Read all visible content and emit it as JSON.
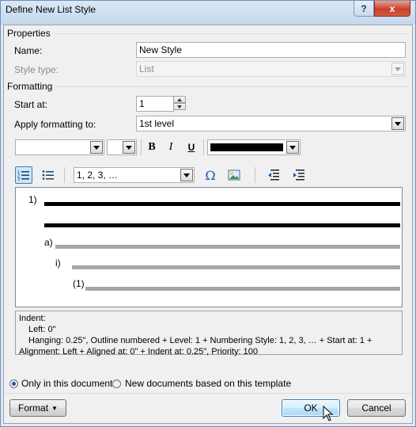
{
  "window": {
    "title": "Define New List Style",
    "help_label": "?",
    "close_label": "x"
  },
  "properties": {
    "group_label": "Properties",
    "name_label": "Name:",
    "name_value": "New Style",
    "style_type_label": "Style type:",
    "style_type_value": "List"
  },
  "formatting": {
    "group_label": "Formatting",
    "start_at_label": "Start at:",
    "start_at_value": "1",
    "apply_label": "Apply formatting to:",
    "apply_value": "1st level",
    "font_name": "",
    "font_size": "",
    "bold_label": "B",
    "italic_label": "I",
    "underline_label": "U",
    "font_color": "#000000",
    "number_style": "1, 2, 3, …",
    "symbol_label": "Ω"
  },
  "preview": {
    "levels": [
      {
        "label": "1)"
      },
      {
        "label": "a)"
      },
      {
        "label": "i)"
      },
      {
        "label": "(1)"
      }
    ]
  },
  "description": {
    "line1": "Indent:",
    "line2": "Left:  0\"",
    "line3": "Hanging:  0.25\", Outline numbered + Level: 1 + Numbering Style: 1, 2, 3, … + Start at: 1 +",
    "line4": "Alignment: Left + Aligned at:  0\" + Indent at:  0.25\", Priority: 100"
  },
  "scope": {
    "only_doc_label": "Only in this document",
    "template_label": "New documents based on this template",
    "selected": "only_doc"
  },
  "buttons": {
    "format_label": "Format",
    "ok_label": "OK",
    "cancel_label": "Cancel"
  },
  "colors": {
    "accent": "#3c7fb1",
    "bar_dark": "#000000",
    "bar_light": "#a6a6a6",
    "close": "#c8412b"
  }
}
